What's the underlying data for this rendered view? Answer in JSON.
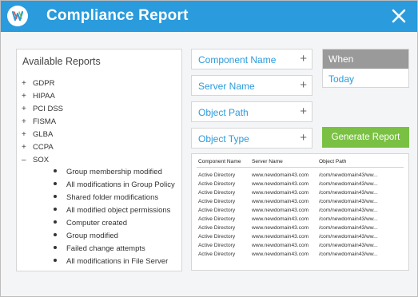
{
  "window": {
    "title": "Compliance Report",
    "accent_color": "#2a9bdc",
    "close_icon": "close-icon",
    "logo_icon": "app-logo-icon"
  },
  "reports": {
    "heading": "Available Reports",
    "items": [
      {
        "toggle": "+",
        "label": "GDPR"
      },
      {
        "toggle": "+",
        "label": "HIPAA"
      },
      {
        "toggle": "+",
        "label": "PCI DSS"
      },
      {
        "toggle": "+",
        "label": "FISMA"
      },
      {
        "toggle": "+",
        "label": "GLBA"
      },
      {
        "toggle": "+",
        "label": "CCPA"
      },
      {
        "toggle": "–",
        "label": "SOX"
      }
    ],
    "sox_children": [
      "Group membership modified",
      "All modifications in Group Policy",
      "Shared folder modifications",
      "All modified object permissions",
      "Computer created",
      "Group modified",
      "Failed change attempts",
      "All modifications in File Server"
    ]
  },
  "filters": {
    "component_name": "Component Name",
    "server_name": "Server Name",
    "object_path": "Object Path",
    "object_type": "Object Type",
    "expand_symbol": "+"
  },
  "when": {
    "heading": "When",
    "value": "Today"
  },
  "generate_button": {
    "label": "Generate Report",
    "color": "#7ac143"
  },
  "results_table": {
    "headers": [
      "Component Name",
      "Server Name",
      "Object Path"
    ],
    "rows": [
      [
        "Active Directory",
        "www.newdomain43.com",
        "/com/newdomain43/ww..."
      ],
      [
        "Active Directory",
        "www.newdomain43.com",
        "/com/newdomain43/ww..."
      ],
      [
        "Active Directory",
        "www.newdomain43.com",
        "/com/newdomain43/ww..."
      ],
      [
        "Active Directory",
        "www.newdomain43.com",
        "/com/newdomain43/ww..."
      ],
      [
        "Active Directory",
        "www.newdomain43.com",
        "/com/newdomain43/ww..."
      ],
      [
        "Active Directory",
        "www.newdomain43.com",
        "/com/newdomain43/ww..."
      ],
      [
        "Active Directory",
        "www.newdomain43.com",
        "/com/newdomain43/ww..."
      ],
      [
        "Active Directory",
        "www.newdomain43.com",
        "/com/newdomain43/ww..."
      ],
      [
        "Active Directory",
        "www.newdomain43.com",
        "/com/newdomain43/ww..."
      ],
      [
        "Active Directory",
        "www.newdomain43.com",
        "/com/newdomain43/ww..."
      ]
    ]
  }
}
